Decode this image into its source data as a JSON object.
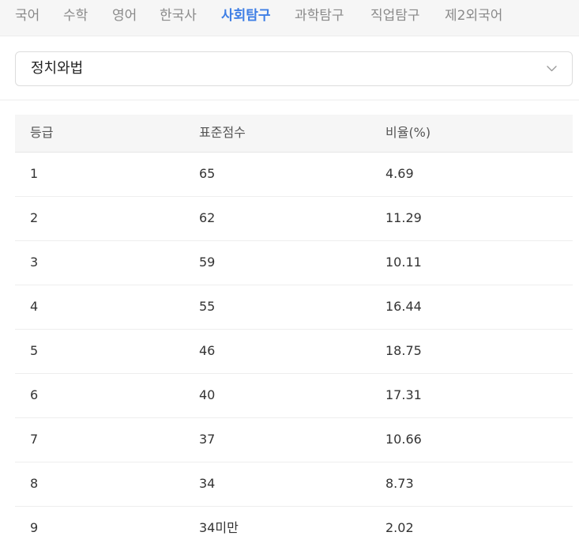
{
  "tabs": [
    {
      "label": "국어",
      "active": false
    },
    {
      "label": "수학",
      "active": false
    },
    {
      "label": "영어",
      "active": false
    },
    {
      "label": "한국사",
      "active": false
    },
    {
      "label": "사회탐구",
      "active": true
    },
    {
      "label": "과학탐구",
      "active": false
    },
    {
      "label": "직업탐구",
      "active": false
    },
    {
      "label": "제2외국어",
      "active": false
    }
  ],
  "subject_select": {
    "value": "정치와법",
    "icon": "chevron-down-icon"
  },
  "table": {
    "headers": [
      "등급",
      "표준점수",
      "비율(%)"
    ],
    "rows": [
      [
        "1",
        "65",
        "4.69"
      ],
      [
        "2",
        "62",
        "11.29"
      ],
      [
        "3",
        "59",
        "10.11"
      ],
      [
        "4",
        "55",
        "16.44"
      ],
      [
        "5",
        "46",
        "18.75"
      ],
      [
        "6",
        "40",
        "17.31"
      ],
      [
        "7",
        "37",
        "10.66"
      ],
      [
        "8",
        "34",
        "8.73"
      ],
      [
        "9",
        "34미만",
        "2.02"
      ]
    ]
  },
  "colors": {
    "active_tab": "#3f7fe5",
    "inactive_tab": "#8a8a8a",
    "tabbar_bg": "#f6f6f6",
    "header_bg": "#f6f6f6"
  }
}
